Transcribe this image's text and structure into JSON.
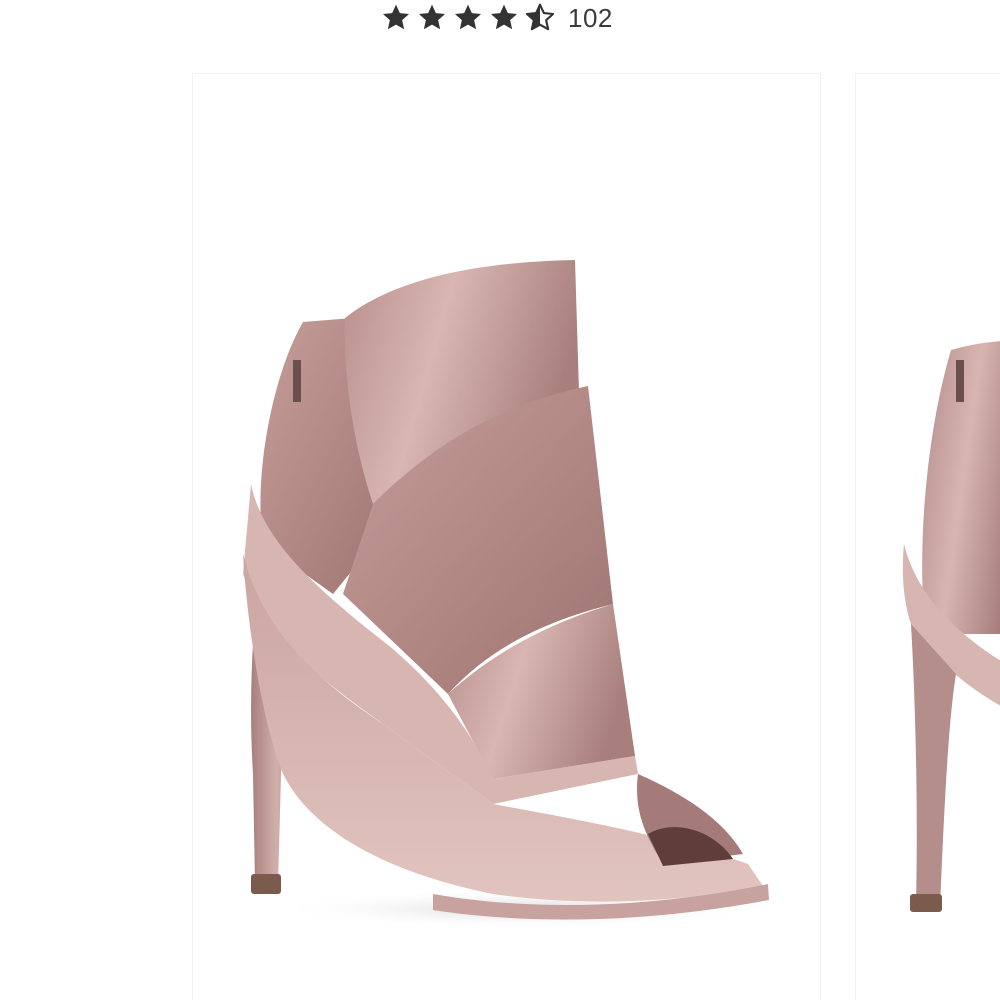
{
  "rating": {
    "value": 4.5,
    "max": 5,
    "review_count": "102",
    "star_color": "#333333"
  },
  "carousel": {
    "items": [
      {
        "image": "pink-satin-peep-toe-bootie",
        "color": "#c9a3a0"
      },
      {
        "image": "pink-satin-peep-toe-bootie-next",
        "color": "#c9a3a0"
      }
    ]
  }
}
